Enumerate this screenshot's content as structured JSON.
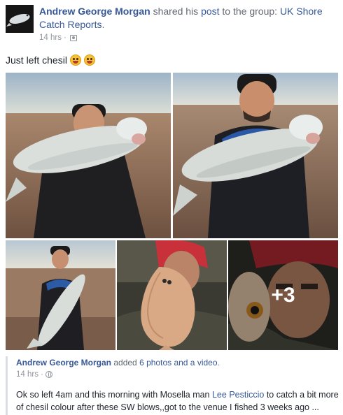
{
  "post": {
    "author": "Andrew George Morgan",
    "action_text": "shared his",
    "post_link": "post",
    "to_text": "to the group:",
    "group": "UK Shore Catch Reports",
    "period": ".",
    "time": "14 hrs",
    "separator": "·",
    "audience_icon": "group-audience-icon",
    "message": "Just left chesil",
    "emojis": [
      "winking-tongue-emoji",
      "winking-tongue-emoji"
    ]
  },
  "photos": {
    "more_count": "+3"
  },
  "shared": {
    "author": "Andrew George Morgan",
    "action_text": "added",
    "added_link": "6 photos and a video",
    "period": ".",
    "time": "14 hrs",
    "separator": "·",
    "audience_icon": "globe-icon",
    "body_before": "Ok so left 4am and this morning with Mosella man ",
    "mention": "Lee Pesticcio",
    "body_after": " to catch a bit more of chesil colour after these SW blows,,got to the venue I fished 3 weeks ago ..."
  },
  "colors": {
    "link": "#365899",
    "meta": "#90949c",
    "text": "#1d2129"
  }
}
